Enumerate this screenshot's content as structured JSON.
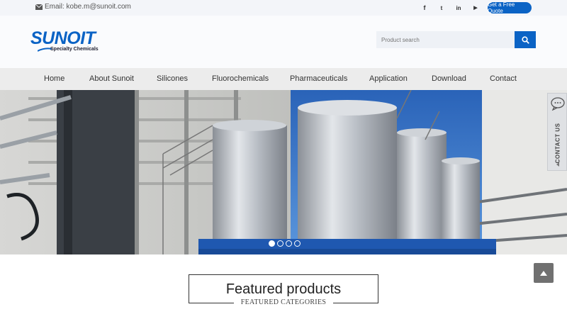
{
  "topbar": {
    "email": "Email: kobe.m@sunoit.com",
    "social": [
      {
        "icon": "facebook-icon",
        "glyph": "f"
      },
      {
        "icon": "twitter-icon",
        "glyph": "t"
      },
      {
        "icon": "linkedin-icon",
        "glyph": "in"
      },
      {
        "icon": "youtube-icon",
        "glyph": "▶"
      }
    ],
    "quote_label": "Get a Free Quote"
  },
  "header": {
    "logo_text": "SUNOIT",
    "logo_sub": "Specialty Chemicals",
    "search_placeholder": "Product search"
  },
  "nav": {
    "items": [
      "Home",
      "About Sunoit",
      "Silicones",
      "Fluorochemicals",
      "Pharmaceuticals",
      "Application",
      "Download",
      "Contact"
    ]
  },
  "banner": {
    "slides_count": 4,
    "active_slide": 1
  },
  "contact_tab": {
    "label": "CONTACT US"
  },
  "featured": {
    "title": "Featured products",
    "subtitle": "FEATURED CATEGORIES"
  },
  "colors": {
    "brand_blue": "#0b63c5",
    "topbar_bg": "#f3f5f9",
    "nav_bg": "#ececec"
  }
}
